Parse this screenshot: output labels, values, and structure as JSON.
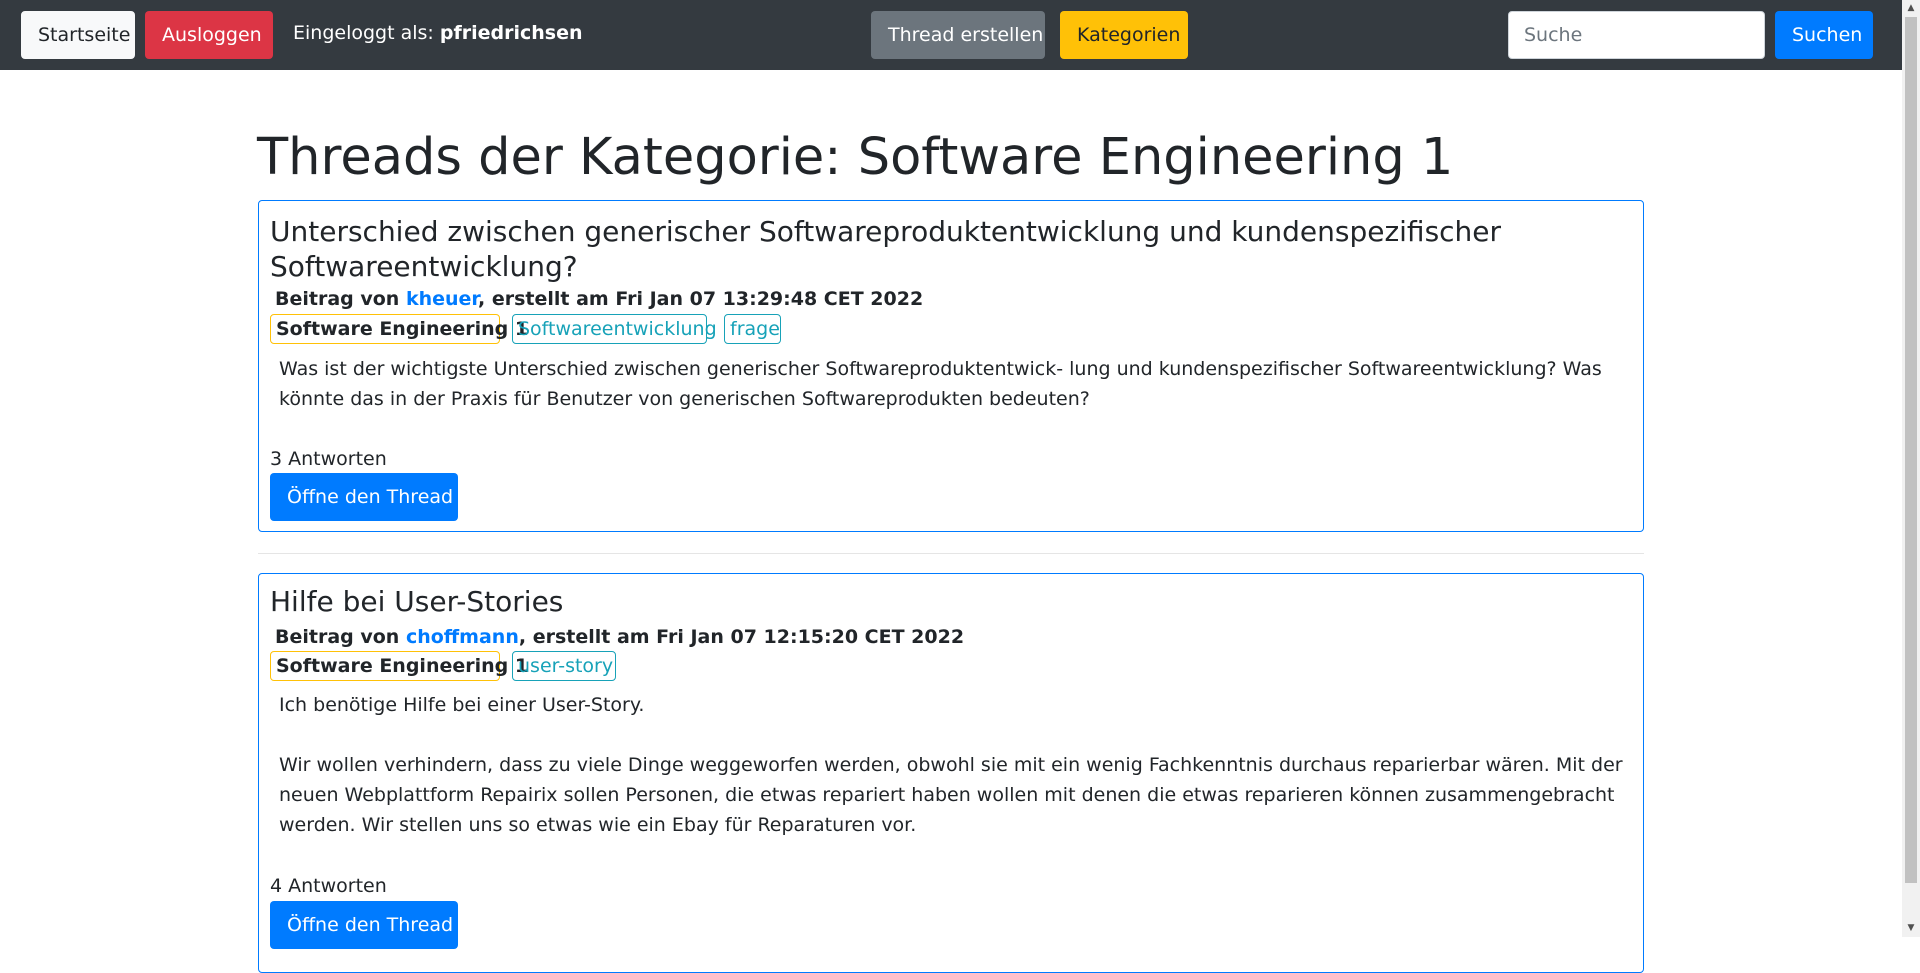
{
  "navbar": {
    "home_label": "Startseite",
    "logout_label": "Ausloggen",
    "logged_in_prefix": "Eingeloggt als: ",
    "username": "pfriedrichsen",
    "create_thread_label": "Thread erstellen",
    "categories_label": "Kategorien",
    "search_placeholder": "Suche",
    "search_button_label": "Suchen"
  },
  "page": {
    "title": "Threads der Kategorie: Software Engineering 1"
  },
  "threads": [
    {
      "title": "Unterschied zwischen generischer Softwareproduktentwicklung und kundenspezifischer Softwareentwicklung?",
      "meta_prefix": "Beitrag von ",
      "author": "kheuer",
      "meta_suffix": ", erstellt am Fri Jan 07 13:29:48 CET 2022",
      "category": "Software Engineering 1",
      "tags": [
        "Softwareentwicklung",
        "frage"
      ],
      "body": [
        "Was ist der wichtigste Unterschied zwischen generischer Softwareproduktentwick- lung und kundenspezifischer Softwareentwicklung? Was könnte das in der Praxis für Benutzer von generischen Softwareprodukten bedeuten?"
      ],
      "replies": "3 Antworten",
      "open_label": "Öffne den Thread"
    },
    {
      "title": "Hilfe bei User-Stories",
      "meta_prefix": "Beitrag von ",
      "author": "choffmann",
      "meta_suffix": ", erstellt am Fri Jan 07 12:15:20 CET 2022",
      "category": "Software Engineering 1",
      "tags": [
        "user-story"
      ],
      "body": [
        "Ich benötige Hilfe bei einer User-Story.",
        "Wir wollen verhindern, dass zu viele Dinge weggeworfen werden, obwohl sie mit ein wenig Fachkenntnis durchaus reparierbar wären. Mit der neuen Webplattform Repairix sollen Personen, die etwas repariert haben wollen mit denen die etwas reparieren können zusammengebracht werden. Wir stellen uns so etwas wie ein Ebay für Reparaturen vor."
      ],
      "replies": "4 Antworten",
      "open_label": "Öffne den Thread"
    }
  ]
}
